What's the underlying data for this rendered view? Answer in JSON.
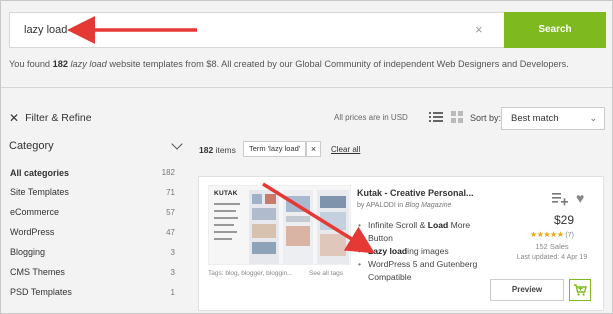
{
  "search": {
    "value": "lazy load",
    "clear_glyph": "×",
    "button_label": "Search"
  },
  "results": {
    "prefix": "You found ",
    "count": "182",
    "query": "lazy load",
    "suffix": " website templates from $8. All created by our Global Community of independent Web Designers and Developers."
  },
  "toolbar": {
    "filter_label": "Filter & Refine",
    "prices_note": "All prices are in USD",
    "sort_label": "Sort by:",
    "sort_value": "Best match"
  },
  "sidebar": {
    "category_title": "Category",
    "items": [
      {
        "label": "All categories",
        "count": "182"
      },
      {
        "label": "Site Templates",
        "count": "71"
      },
      {
        "label": "eCommerce",
        "count": "57"
      },
      {
        "label": "WordPress",
        "count": "47"
      },
      {
        "label": "Blogging",
        "count": "3"
      },
      {
        "label": "CMS Themes",
        "count": "3"
      },
      {
        "label": "PSD Templates",
        "count": "1"
      }
    ]
  },
  "filters": {
    "items_count": "182",
    "items_word": "items",
    "term_tag": "Term 'lazy load'",
    "remove_glyph": "×",
    "clear_all": "Clear all"
  },
  "card": {
    "title": "Kutak - Creative Personal...",
    "by_prefix": "by APALODI in ",
    "category": "Blog Magazine",
    "features": [
      {
        "before": "Infinite Scroll & ",
        "bold": "Load",
        "after": " More Button"
      },
      {
        "before": "",
        "bold": "Lazy load",
        "after": "ing images"
      },
      {
        "before": "WordPress 5 and Gutenberg Compatible",
        "bold": "",
        "after": ""
      }
    ],
    "thumb_brand": "KUTAK",
    "tags": "Tags: blog, blogger, bloggin...",
    "see_all": "See all tags",
    "price": "$29",
    "stars": "★★★★★",
    "rating_count": "(7)",
    "sales": "152 Sales",
    "updated": "Last updated: 4 Apr 19",
    "preview_label": "Preview"
  },
  "colors": {
    "accent_green": "#7eba1f",
    "arrow_red": "#e53935",
    "star": "#f0a30a"
  }
}
